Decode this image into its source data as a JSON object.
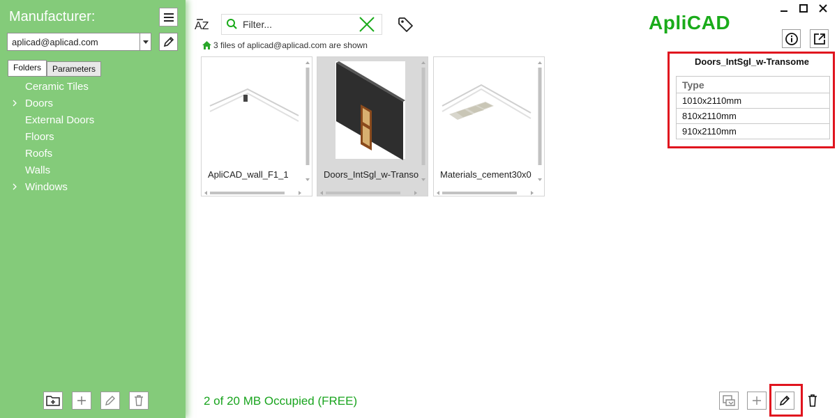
{
  "sidebar": {
    "title": "Manufacturer:",
    "user": "aplicad@aplicad.com",
    "tabs": [
      {
        "label": "Folders",
        "active": true
      },
      {
        "label": "Parameters",
        "active": false
      }
    ],
    "tree": [
      {
        "label": "Ceramic Tiles",
        "expandable": false
      },
      {
        "label": "Doors",
        "expandable": true
      },
      {
        "label": "External Doors",
        "expandable": false
      },
      {
        "label": "Floors",
        "expandable": false
      },
      {
        "label": "Roofs",
        "expandable": false
      },
      {
        "label": "Walls",
        "expandable": false
      },
      {
        "label": "Windows",
        "expandable": true
      }
    ],
    "bottom_icons": [
      "new-folder-icon",
      "plus-icon",
      "pencil-icon",
      "trash-icon"
    ]
  },
  "toolbar": {
    "sort_label": "AZ",
    "filter_placeholder": "Filter...",
    "status": "3 files of aplicad@aplicad.com are shown"
  },
  "files": [
    {
      "label": "ApliCAD_wall_F1_1",
      "selected": false
    },
    {
      "label": "Doors_IntSgl_w-Transome",
      "selected": true
    },
    {
      "label": "Materials_cement30x0",
      "selected": false
    }
  ],
  "brand": "ApliCAD",
  "properties": {
    "title": "Doors_IntSgl_w-Transome",
    "header": "Type",
    "rows": [
      "1010x2110mm",
      "810x2110mm",
      "910x2110mm"
    ]
  },
  "footer": {
    "storage": "2 of 20 MB Occupied (FREE)"
  },
  "colors": {
    "sidebar": "#84cb7a",
    "brand": "#1aab1a",
    "highlight": "#e0141e"
  }
}
